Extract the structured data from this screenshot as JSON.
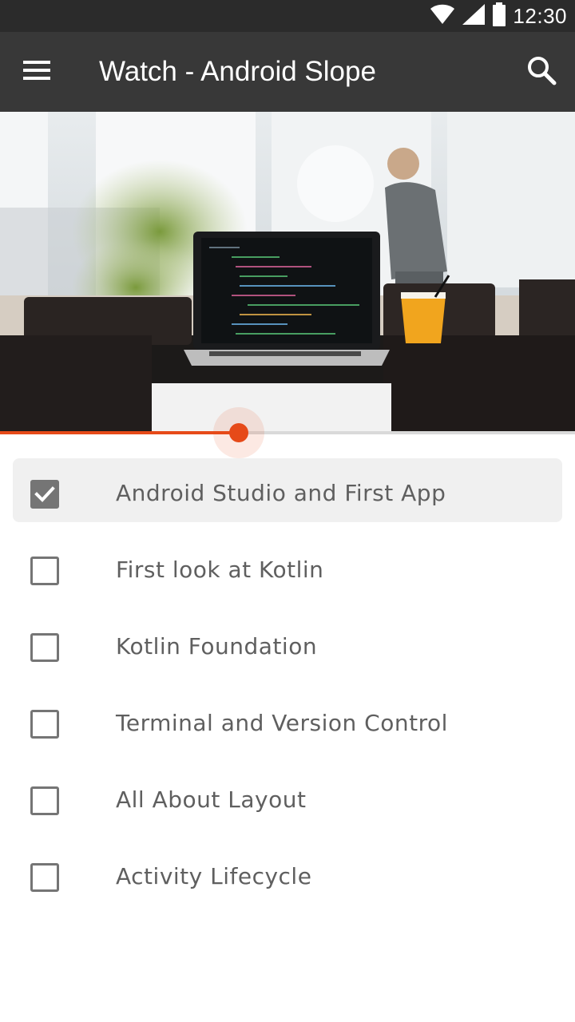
{
  "status_bar": {
    "time": "12:30",
    "icons": [
      "wifi-icon",
      "signal-icon",
      "battery-icon"
    ]
  },
  "app_bar": {
    "title": "Watch - Android Slope",
    "menu_icon": "menu-icon",
    "search_icon": "search-icon"
  },
  "player": {
    "hero_image": "laptop-on-cafe-table-photo",
    "progress": 0.415,
    "accent_color": "#e64a19"
  },
  "episodes": [
    {
      "label": "Android Studio and First App",
      "checked": true
    },
    {
      "label": "First look at Kotlin",
      "checked": false
    },
    {
      "label": "Kotlin Foundation",
      "checked": false
    },
    {
      "label": "Terminal and Version Control",
      "checked": false
    },
    {
      "label": "All About Layout",
      "checked": false
    },
    {
      "label": "Activity Lifecycle",
      "checked": false
    }
  ]
}
